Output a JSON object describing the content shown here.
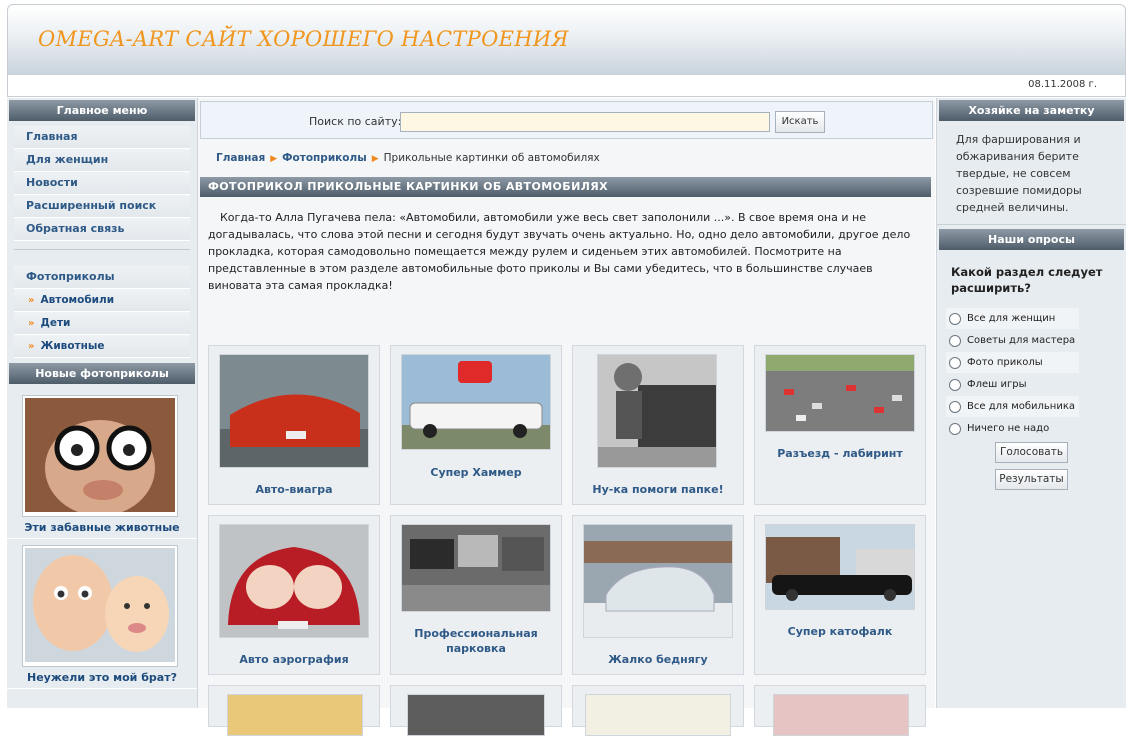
{
  "header": {
    "title": "OMEGA-ART САЙТ ХОРОШЕГО НАСТРОЕНИЯ",
    "date": "08.11.2008 г."
  },
  "left": {
    "main_menu_title": "Главное меню",
    "main_menu": [
      "Главная",
      "Для женщин",
      "Новости",
      "Расширенный поиск",
      "Обратная связь"
    ],
    "photo_menu_title": "Фотоприколы",
    "photo_menu": [
      "Автомобили",
      "Дети",
      "Животные"
    ],
    "new_photos_title": "Новые фотоприколы",
    "new_photos": [
      "Эти забавные животные",
      "Неужели это мой брат?"
    ]
  },
  "search": {
    "label": "Поиск по сайту:",
    "value": "",
    "button": "Искать"
  },
  "breadcrumb": {
    "home": "Главная",
    "section": "Фотоприколы",
    "current": "Прикольные картинки об автомобилях"
  },
  "article": {
    "title": "ФОТОПРИКОЛ ПРИКОЛЬНЫЕ КАРТИНКИ ОБ АВТОМОБИЛЯХ",
    "text": "Когда-то Алла Пугачева пела: «Автомобили, автомобили уже весь свет заполонили ...». В свое время она и не догадывалась, что слова этой песни и сегодня будут звучать очень актуально. Но, одно дело автомобили, другое дело прокладка, которая самодовольно помещается между рулем и сиденьем этих автомобилей. Посмотрите на представленные в этом разделе автомобильные фото приколы и Вы сами убедитесь, что в большинстве случаев виновата эта самая прокладка!"
  },
  "gallery": [
    "Авто-виагра",
    "Супер Хаммер",
    "Ну-ка помоги папке!",
    "Разъезд - лабиринт",
    "Авто аэрография",
    "Профессиональная парковка",
    "Жалко беднягу",
    "Супер катофалк"
  ],
  "right": {
    "tip_title": "Хозяйке на заметку",
    "tip_text": "Для фарширования и обжаривания берите твердые, не совсем созревшие помидоры средней величины.",
    "poll_title": "Наши опросы",
    "poll_question": "Какой раздел следует расширить?",
    "poll_options": [
      "Все для женщин",
      "Советы для мастера",
      "Фото приколы",
      "Флеш игры",
      "Все для мобильника",
      "Ничего не надо"
    ],
    "vote_button": "Голосовать",
    "results_button": "Результаты"
  }
}
